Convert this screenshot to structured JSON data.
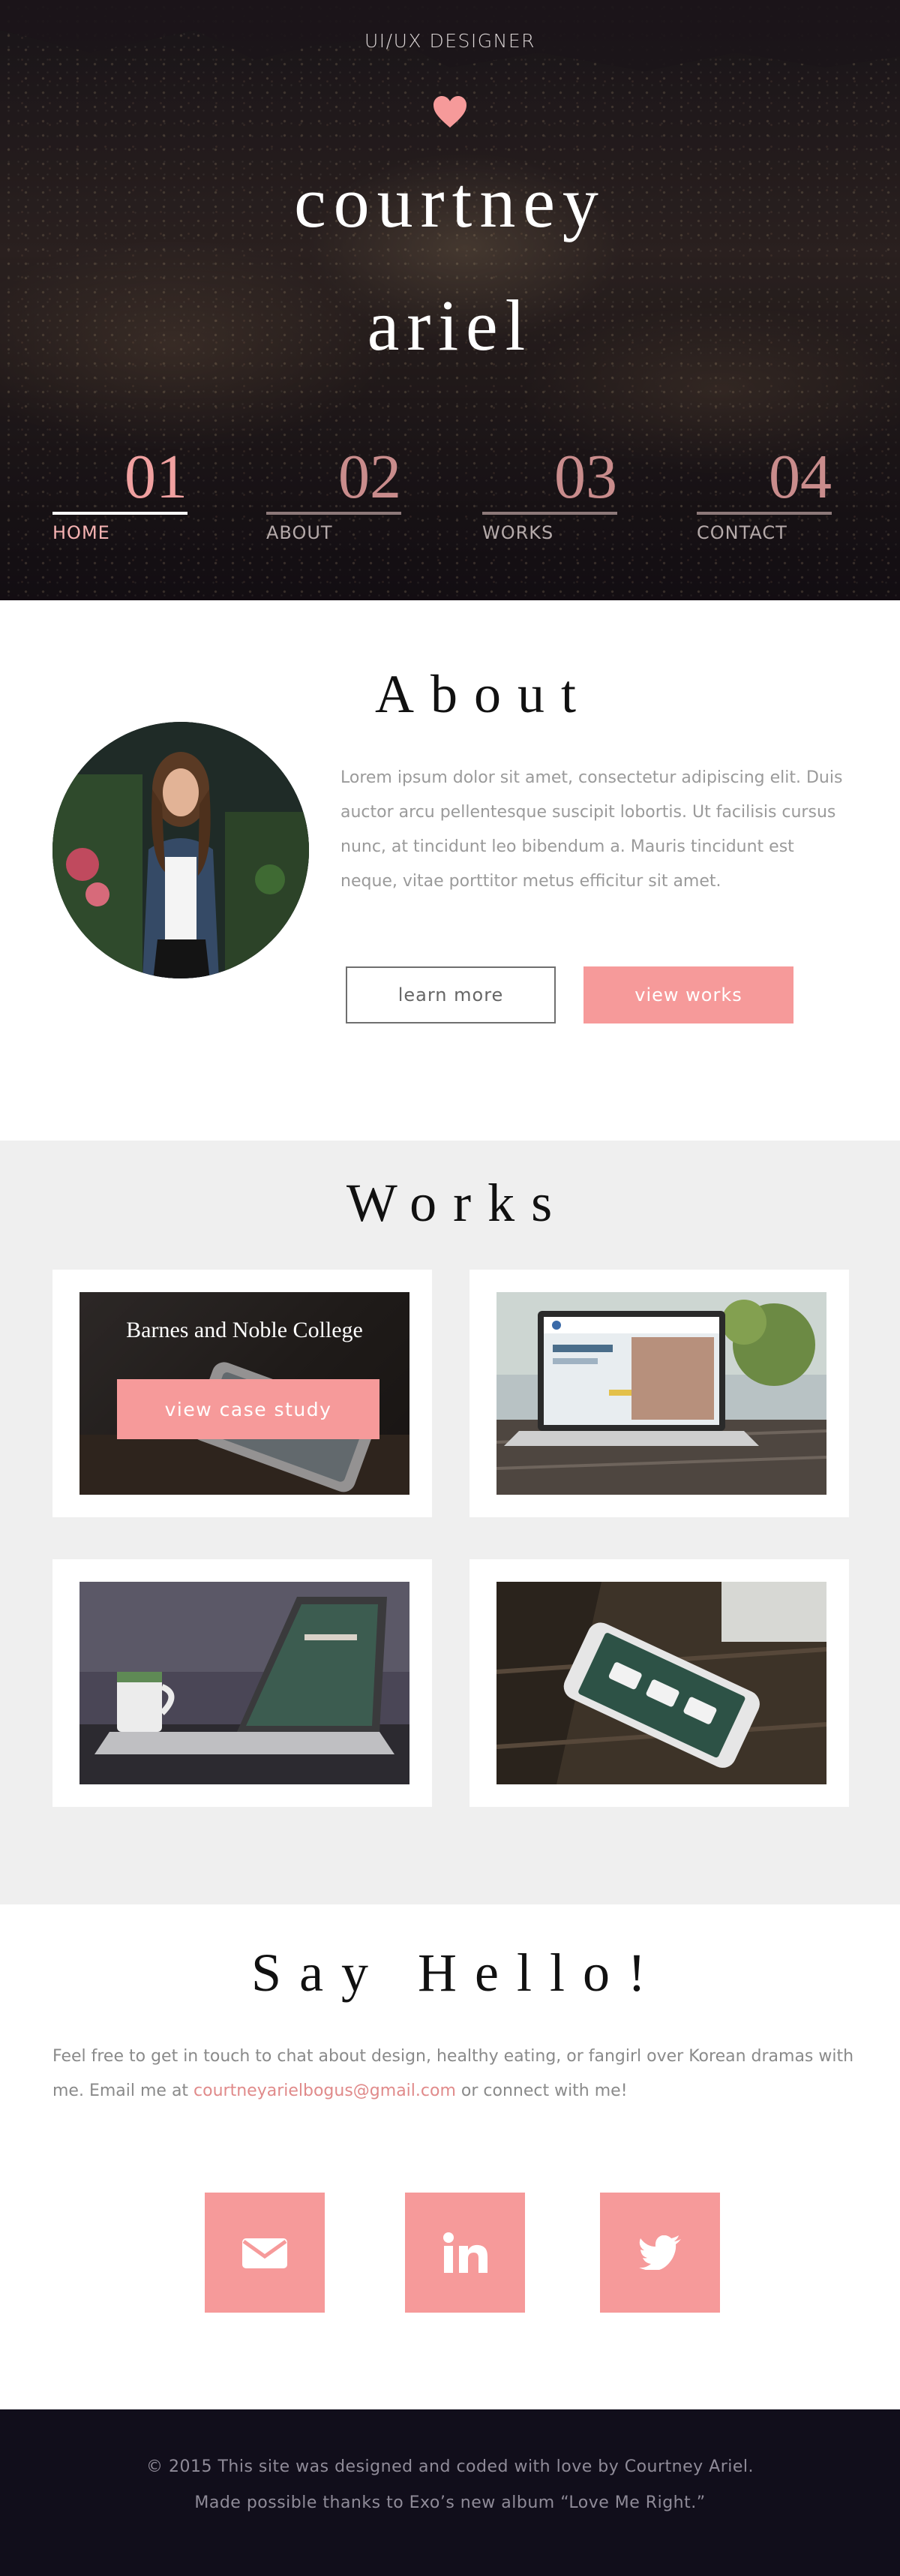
{
  "hero": {
    "tagline": "UI/UX DESIGNER",
    "name_first": "courtney",
    "name_last": "ariel",
    "nav": [
      {
        "number": "01",
        "label": "HOME",
        "active": true
      },
      {
        "number": "02",
        "label": "ABOUT",
        "active": false
      },
      {
        "number": "03",
        "label": "WORKS",
        "active": false
      },
      {
        "number": "04",
        "label": "CONTACT",
        "active": false
      }
    ]
  },
  "about": {
    "title": "About",
    "text": "Lorem ipsum dolor sit amet, consectetur adipiscing elit. Duis auctor arcu pellentesque suscipit lobortis. Ut facilisis cursus nunc, at tincidunt leo bibendum a. Mauris tincidunt est neque, vitae porttitor metus efficitur sit amet.",
    "learn_more": "learn more",
    "view_works": "view works"
  },
  "works": {
    "title": "Works",
    "featured_title": "Barnes and Noble College",
    "case_study": "view case study"
  },
  "hello": {
    "title": "Say Hello!",
    "text_before": "Feel free to get in touch to chat about design, healthy eating, or fangirl over Korean dramas with me. Email me at ",
    "email": "courtneyarielbogus@gmail.com",
    "text_after": " or connect with me!",
    "social": [
      "envelope-icon",
      "linkedin-icon",
      "twitter-icon"
    ]
  },
  "footer": {
    "line1": "© 2015 This site was designed and coded with love by Courtney Ariel.",
    "line2": "Made possible thanks to Exo’s new album “Love Me Right.”"
  },
  "colors": {
    "accent": "#f69a9a",
    "footer_bg": "#110e1b",
    "works_bg": "#efefef"
  }
}
